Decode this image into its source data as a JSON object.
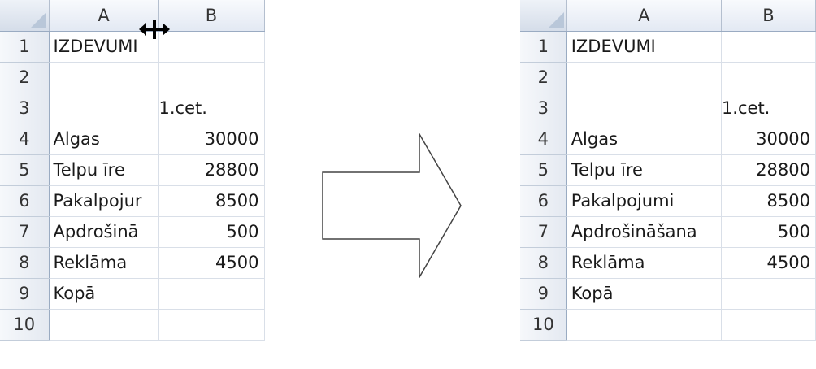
{
  "before": {
    "column_headers": [
      "A",
      "B"
    ],
    "rows": [
      {
        "num": "1",
        "a": "IZDEVUMI",
        "b": ""
      },
      {
        "num": "2",
        "a": "",
        "b": ""
      },
      {
        "num": "3",
        "a": "",
        "b": "1.cet."
      },
      {
        "num": "4",
        "a": "Algas",
        "b": "30000"
      },
      {
        "num": "5",
        "a": "Telpu īre",
        "b": "28800"
      },
      {
        "num": "6",
        "a": "Pakalpojur",
        "b": "8500"
      },
      {
        "num": "7",
        "a": "Apdrošinā",
        "b": "500"
      },
      {
        "num": "8",
        "a": "Reklāma",
        "b": "4500"
      },
      {
        "num": "9",
        "a": "Kopā",
        "b": ""
      },
      {
        "num": "10",
        "a": "",
        "b": ""
      }
    ]
  },
  "after": {
    "column_headers": [
      "A",
      "B"
    ],
    "rows": [
      {
        "num": "1",
        "a": "IZDEVUMI",
        "b": ""
      },
      {
        "num": "2",
        "a": "",
        "b": ""
      },
      {
        "num": "3",
        "a": "",
        "b": "1.cet."
      },
      {
        "num": "4",
        "a": "Algas",
        "b": "30000"
      },
      {
        "num": "5",
        "a": "Telpu īre",
        "b": "28800"
      },
      {
        "num": "6",
        "a": "Pakalpojumi",
        "b": "8500"
      },
      {
        "num": "7",
        "a": "Apdrošināšana",
        "b": "500"
      },
      {
        "num": "8",
        "a": "Reklāma",
        "b": "4500"
      },
      {
        "num": "9",
        "a": "Kopā",
        "b": ""
      },
      {
        "num": "10",
        "a": "",
        "b": ""
      }
    ]
  },
  "icons": {
    "cursor": "column-resize-cursor-icon",
    "arrow": "right-arrow-icon"
  },
  "colors": {
    "header_gradient_top": "#f8fafd",
    "header_gradient_bottom": "#e3e9f3",
    "gridline": "#d9dfe8",
    "corner_triangle": "#b9c7d9"
  }
}
